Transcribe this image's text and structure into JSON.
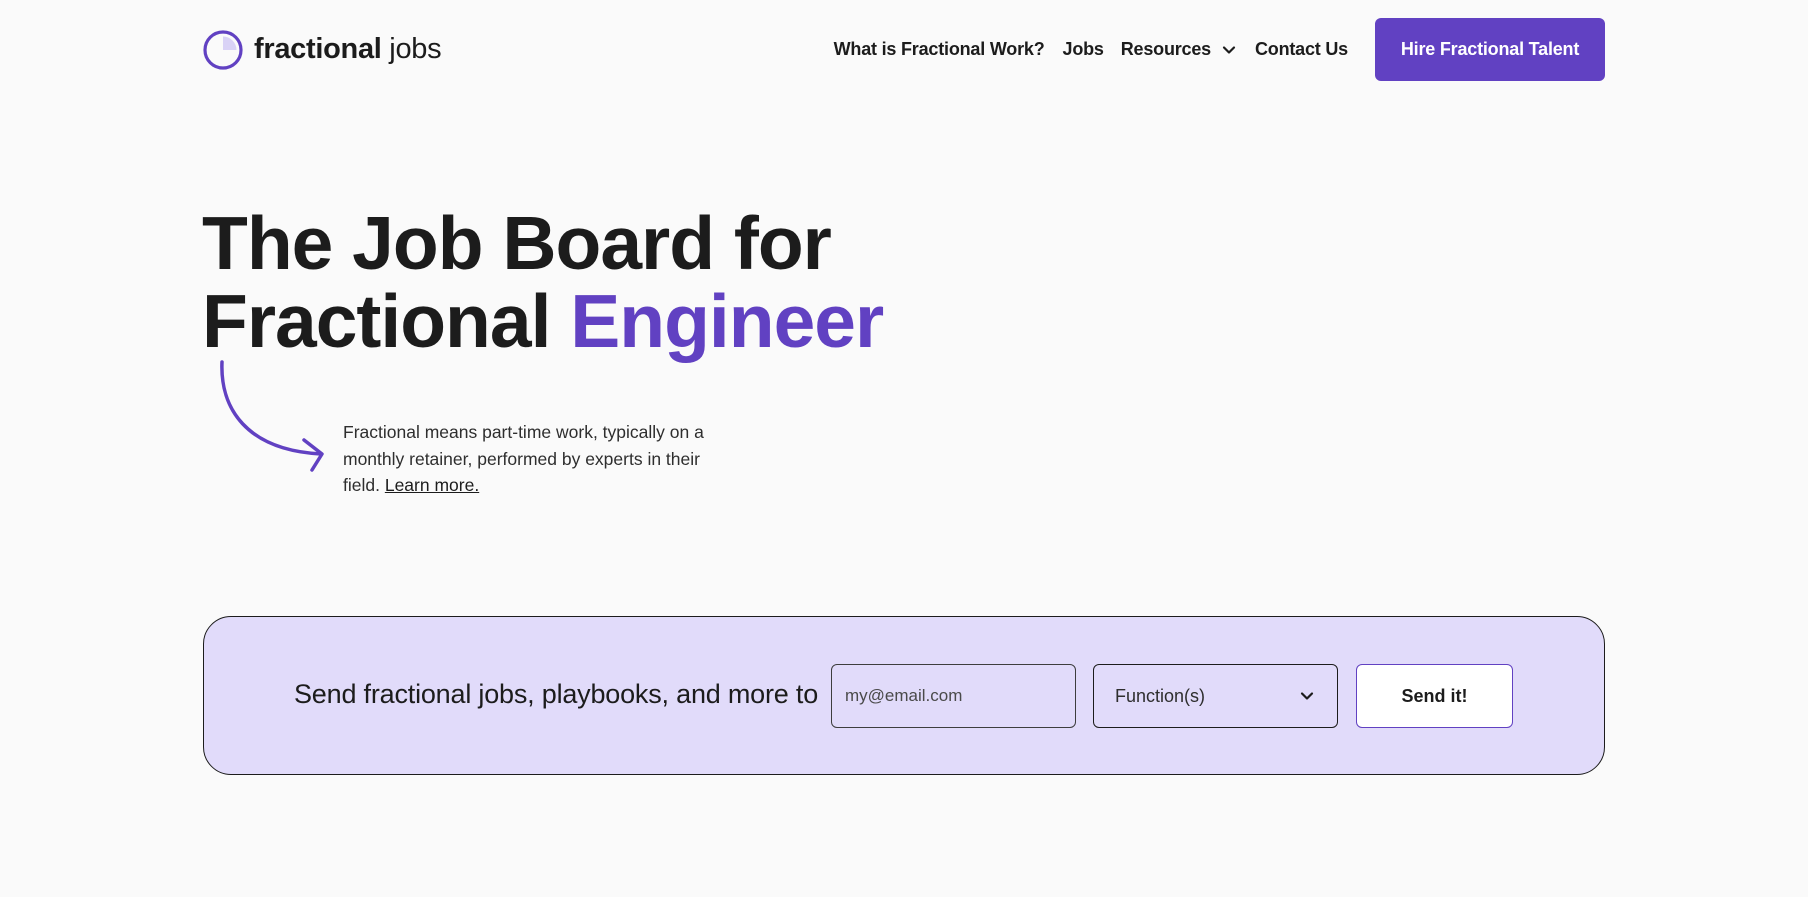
{
  "brand": {
    "name_bold": "fractional",
    "name_light": "jobs",
    "accent_color": "#6141c2",
    "logo_icon": "half-filled-circle-icon"
  },
  "nav": {
    "items": [
      {
        "label": "What is Fractional Work?"
      },
      {
        "label": "Jobs"
      },
      {
        "label": "Resources",
        "icon": "chevron-down-icon"
      },
      {
        "label": "Contact Us"
      }
    ],
    "cta_label": "Hire Fractional Talent"
  },
  "hero": {
    "title_line1": "The Job Board for",
    "title_line2_start": "Fractional",
    "title_line2_accent": "Engineer",
    "arrow_icon": "curved-arrow-icon",
    "description": "Fractional means part-time work, typically on a monthly retainer, performed by experts in their field.",
    "learn_more_label": "Learn more."
  },
  "subscribe": {
    "text": "Send fractional jobs, playbooks, and more to",
    "email_placeholder": "my@email.com",
    "email_value": "",
    "function_selected": "Function(s)",
    "submit_label": "Send it!",
    "background_color": "#e1dbfa"
  }
}
